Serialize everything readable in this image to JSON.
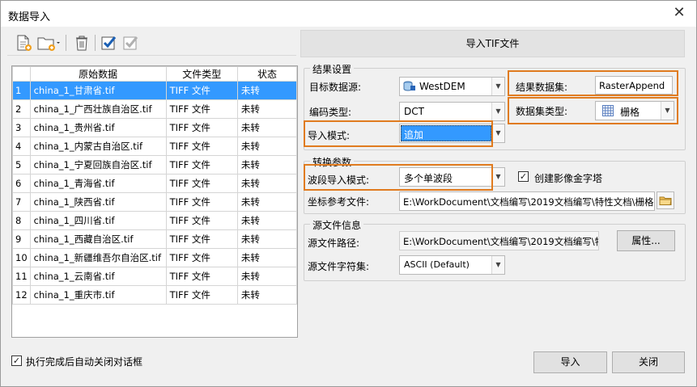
{
  "window": {
    "title": "数据导入",
    "close_glyph": "✕"
  },
  "header": {
    "title": "导入TIF文件"
  },
  "grid": {
    "columns": [
      "原始数据",
      "文件类型",
      "状态"
    ],
    "rows": [
      [
        "1",
        "china_1_甘肃省.tif",
        "TIFF 文件",
        "未转"
      ],
      [
        "2",
        "china_1_广西壮族自治区.tif",
        "TIFF 文件",
        "未转"
      ],
      [
        "3",
        "china_1_贵州省.tif",
        "TIFF 文件",
        "未转"
      ],
      [
        "4",
        "china_1_内蒙古自治区.tif",
        "TIFF 文件",
        "未转"
      ],
      [
        "5",
        "china_1_宁夏回族自治区.tif",
        "TIFF 文件",
        "未转"
      ],
      [
        "6",
        "china_1_青海省.tif",
        "TIFF 文件",
        "未转"
      ],
      [
        "7",
        "china_1_陕西省.tif",
        "TIFF 文件",
        "未转"
      ],
      [
        "8",
        "china_1_四川省.tif",
        "TIFF 文件",
        "未转"
      ],
      [
        "9",
        "china_1_西藏自治区.tif",
        "TIFF 文件",
        "未转"
      ],
      [
        "10",
        "china_1_新疆维吾尔自治区.tif",
        "TIFF 文件",
        "未转"
      ],
      [
        "11",
        "china_1_云南省.tif",
        "TIFF 文件",
        "未转"
      ],
      [
        "12",
        "china_1_重庆市.tif",
        "TIFF 文件",
        "未转"
      ]
    ],
    "selected_row": 0
  },
  "result": {
    "legend": "结果设置",
    "target_source_label": "目标数据源:",
    "target_source_value": "WestDEM",
    "result_dataset_label": "结果数据集:",
    "result_dataset_value": "RasterAppend",
    "encoding_label": "编码类型:",
    "encoding_value": "DCT",
    "dataset_type_label": "数据集类型:",
    "dataset_type_value": "栅格",
    "import_mode_label": "导入模式:",
    "import_mode_value": "追加"
  },
  "convert": {
    "legend": "转换参数",
    "band_mode_label": "波段导入模式:",
    "band_mode_value": "多个单波段",
    "pyramid_label": "创建影像金字塔",
    "pyramid_checked": true,
    "crs_label": "坐标参考文件:",
    "crs_value": "E:\\WorkDocument\\文档编写\\2019文档编写\\特性文档\\栅格追"
  },
  "source": {
    "legend": "源文件信息",
    "path_label": "源文件路径:",
    "path_value": "E:\\WorkDocument\\文档编写\\2019文档编写\\特性",
    "props_button": "属性...",
    "charset_label": "源文件字符集:",
    "charset_value": "ASCII (Default)"
  },
  "footer": {
    "auto_close_label": "执行完成后自动关闭对话框",
    "auto_close_checked": true,
    "import_button": "导入",
    "close_button": "关闭"
  },
  "colors": {
    "selection": "#3399ff",
    "highlight": "#e07b1f",
    "check": "#1a5fb4"
  }
}
